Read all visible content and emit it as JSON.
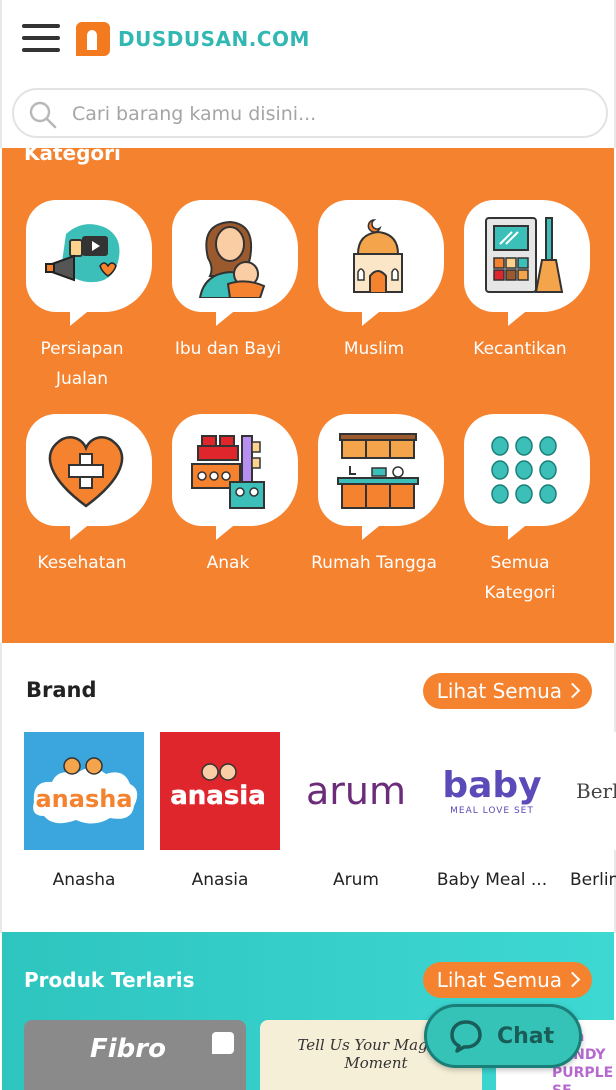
{
  "header": {
    "logo_text": "DUSDUSAN.COM"
  },
  "search": {
    "placeholder": "Cari barang kamu disini..."
  },
  "categories": {
    "title": "Kategori",
    "items": [
      {
        "label": "Persiapan Jualan",
        "icon": "megaphone-icon"
      },
      {
        "label": "Ibu dan Bayi",
        "icon": "mother-baby-icon"
      },
      {
        "label": "Muslim",
        "icon": "mosque-icon"
      },
      {
        "label": "Kecantikan",
        "icon": "makeup-palette-icon"
      },
      {
        "label": "Kesehatan",
        "icon": "heart-plus-icon"
      },
      {
        "label": "Anak",
        "icon": "toy-blocks-icon"
      },
      {
        "label": "Rumah Tangga",
        "icon": "kitchen-icon"
      },
      {
        "label": "Semua Kategori",
        "icon": "grid-dots-icon"
      }
    ]
  },
  "brand": {
    "title": "Brand",
    "see_all": "Lihat Semua",
    "items": [
      {
        "name": "Anasha",
        "logo_text": "anasha",
        "bg": "#3aa6dd"
      },
      {
        "name": "Anasia",
        "logo_text": "anasia",
        "bg": "#e0262d"
      },
      {
        "name": "Arum",
        "logo_text": "arum",
        "bg": "#ffffff"
      },
      {
        "name": "Baby Meal ...",
        "logo_text": "baby",
        "logo_sub": "MEAL LOVE SET",
        "bg": "#ffffff"
      },
      {
        "name": "Berlin",
        "logo_text": "Berlin",
        "bg": "#ffffff"
      }
    ]
  },
  "best_sellers": {
    "title": "Produk Terlaris",
    "see_all": "Lihat Semua",
    "products": [
      {
        "label": "Fibro"
      },
      {
        "label": "Tell Us Your Magical Moment"
      },
      {
        "label": "sma CANDY PURPLE SE"
      }
    ]
  },
  "chat": {
    "label": "Chat"
  },
  "colors": {
    "accent_orange": "#f4822f",
    "teal": "#32b8b3",
    "chat_bg": "#35c3b7"
  }
}
